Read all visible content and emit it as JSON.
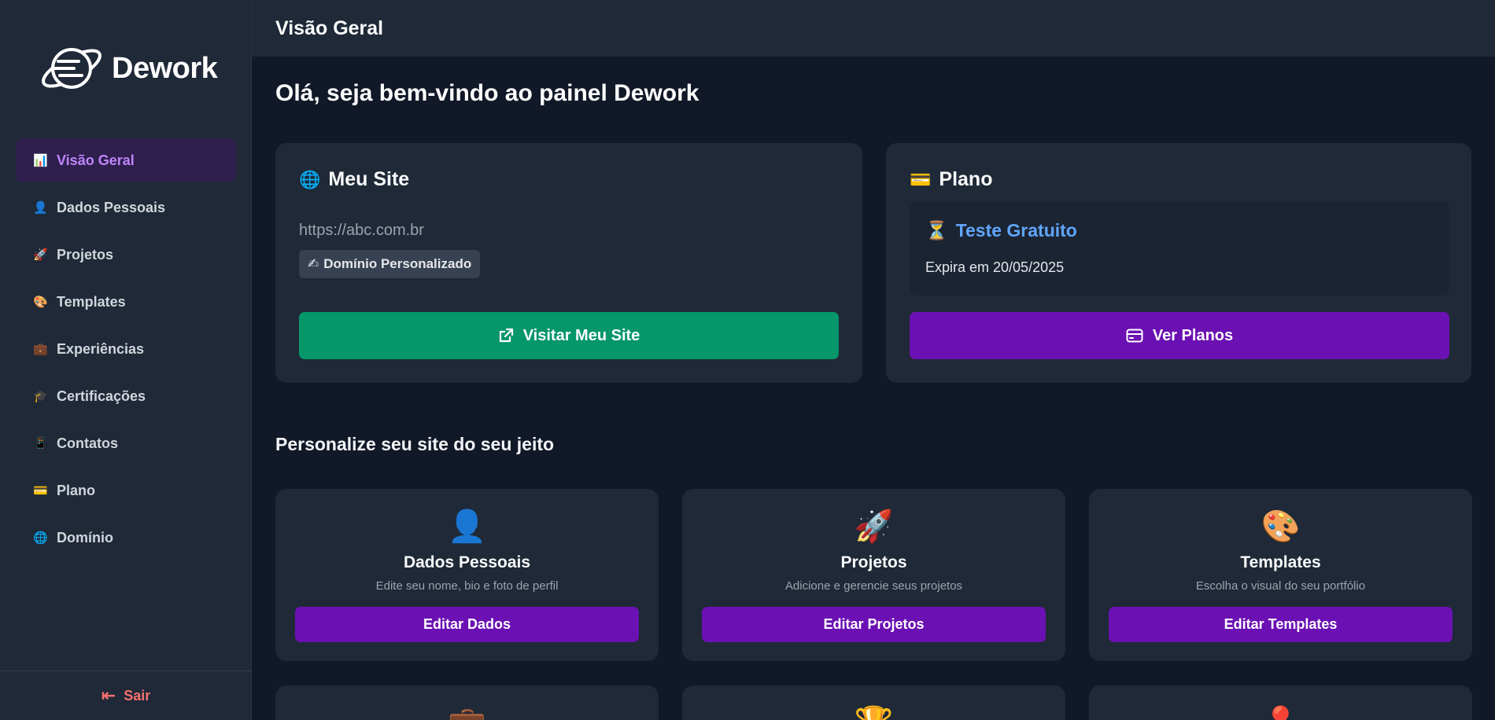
{
  "brand": {
    "name": "Dework"
  },
  "sidebar": {
    "items": [
      {
        "label": "Visão Geral",
        "icon": "📊",
        "active": true
      },
      {
        "label": "Dados Pessoais",
        "icon": "👤",
        "active": false
      },
      {
        "label": "Projetos",
        "icon": "🚀",
        "active": false
      },
      {
        "label": "Templates",
        "icon": "🎨",
        "active": false
      },
      {
        "label": "Experiências",
        "icon": "💼",
        "active": false
      },
      {
        "label": "Certificações",
        "icon": "🎓",
        "active": false
      },
      {
        "label": "Contatos",
        "icon": "📱",
        "active": false
      },
      {
        "label": "Plano",
        "icon": "💳",
        "active": false
      },
      {
        "label": "Domínio",
        "icon": "🌐",
        "active": false
      }
    ],
    "logout": {
      "label": "Sair",
      "icon": "⇤"
    }
  },
  "header": {
    "title": "Visão Geral"
  },
  "main": {
    "welcome": "Olá, seja bem-vindo ao painel Dework",
    "site_card": {
      "icon": "🌐",
      "title": "Meu Site",
      "url": "https://abc.com.br",
      "badge_icon": "✍",
      "badge": "Domínio Personalizado",
      "button_icon": "↗",
      "button": "Visitar Meu Site"
    },
    "plan_card": {
      "icon": "💳",
      "title": "Plano",
      "plan_icon": "⏳",
      "plan_name": "Teste Gratuito",
      "expiry": "Expira em 20/05/2025",
      "button_icon": "▭",
      "button": "Ver Planos"
    },
    "section_title": "Personalize seu site do seu jeito",
    "features": [
      {
        "icon": "👤",
        "name": "Dados Pessoais",
        "description": "Edite seu nome, bio e foto de perfil",
        "button": "Editar Dados"
      },
      {
        "icon": "🚀",
        "name": "Projetos",
        "description": "Adicione e gerencie seus projetos",
        "button": "Editar Projetos"
      },
      {
        "icon": "🎨",
        "name": "Templates",
        "description": "Escolha o visual do seu portfólio",
        "button": "Editar Templates"
      }
    ],
    "partial_features": [
      {
        "icon": "💼"
      },
      {
        "icon": "🏆"
      },
      {
        "icon": "📍"
      }
    ]
  },
  "colors": {
    "background": "#111827",
    "panel": "#1f2937",
    "accent_purple": "#6b11b3",
    "accent_green": "#059669",
    "active_nav_text": "#c084fc",
    "plan_link": "#60a5fa",
    "logout": "#f87171"
  }
}
